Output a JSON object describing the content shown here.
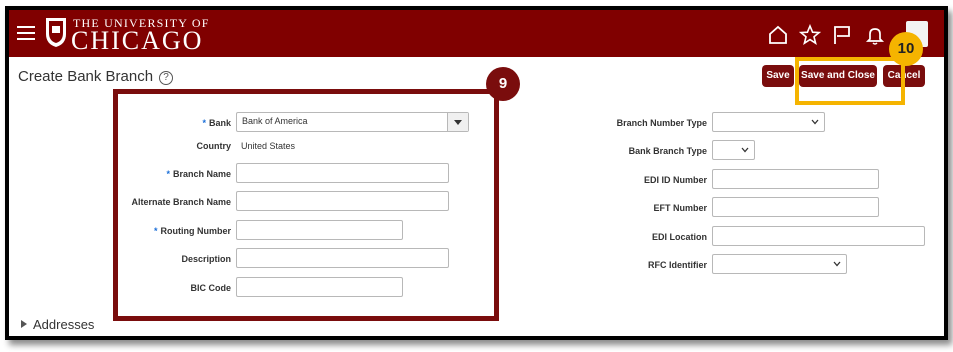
{
  "header": {
    "logo_top": "THE UNIVERSITY OF",
    "logo_bottom": "CHICAGO"
  },
  "page": {
    "title": "Create Bank Branch",
    "help_icon": "?"
  },
  "toolbar": {
    "save": "Save",
    "save_and_close": "Save and Close",
    "cancel": "Cancel"
  },
  "form_left": {
    "bank_label": "Bank",
    "bank_value": "Bank of America",
    "country_label": "Country",
    "country_value": "United States",
    "branch_name_label": "Branch Name",
    "alternate_branch_name_label": "Alternate Branch Name",
    "routing_number_label": "Routing Number",
    "description_label": "Description",
    "bic_code_label": "BIC Code"
  },
  "form_right": {
    "branch_number_type_label": "Branch Number Type",
    "bank_branch_type_label": "Bank Branch Type",
    "edi_id_number_label": "EDI ID Number",
    "eft_number_label": "EFT Number",
    "edi_location_label": "EDI Location",
    "rfc_identifier_label": "RFC Identifier"
  },
  "required_marker": "*",
  "callouts": {
    "step9": "9",
    "step10": "10"
  },
  "addresses": {
    "label": "Addresses"
  },
  "colors": {
    "brand": "#800000",
    "button": "#7a0d0d",
    "highlight_box": "#f5b400",
    "required": "#1a6ed8"
  }
}
